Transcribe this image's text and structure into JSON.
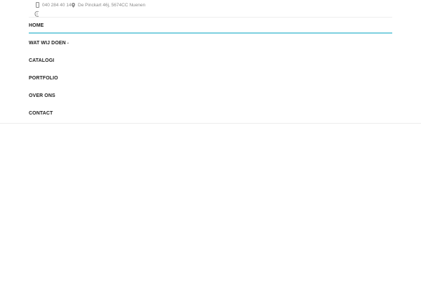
{
  "topbar": {
    "phone": "040 284 40 14",
    "address": "De Pinckart 46j, 5674CC Nuenen",
    "phone_icon": "phone-icon",
    "address_icon": "map-pin-icon"
  },
  "logo": {
    "icon": "logo-icon"
  },
  "nav": {
    "items": [
      {
        "label": "HOME",
        "active": true
      },
      {
        "label": "WAT WIJ DOEN",
        "has_dropdown": true
      },
      {
        "label": "CATALOGI"
      },
      {
        "label": "PORTFOLIO"
      },
      {
        "label": "OVER ONS"
      },
      {
        "label": "CONTACT"
      }
    ],
    "dropdown_caret": "⌄",
    "active_color": "#7dd0e0"
  }
}
